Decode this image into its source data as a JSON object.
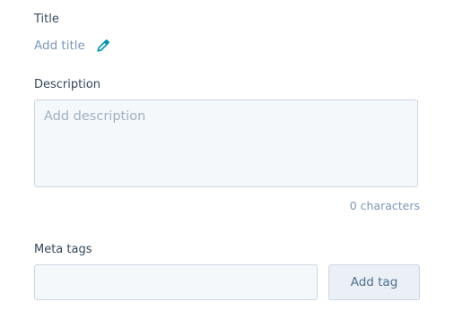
{
  "title_section": {
    "label": "Title",
    "add_title_text": "Add title",
    "edit_icon": "pencil-icon"
  },
  "description_section": {
    "label": "Description",
    "placeholder": "Add description",
    "value": "",
    "char_count_text": "0 characters"
  },
  "meta_tags_section": {
    "label": "Meta tags",
    "input_value": "",
    "add_button_label": "Add tag"
  },
  "colors": {
    "label_text": "#33475b",
    "link_text": "#7c98b6",
    "placeholder": "#9fb1c4",
    "input_bg": "#f5f8fa",
    "input_border": "#cbd6e2",
    "button_bg": "#eaf0f6",
    "button_text": "#506e91",
    "pencil": "#0091ae"
  }
}
